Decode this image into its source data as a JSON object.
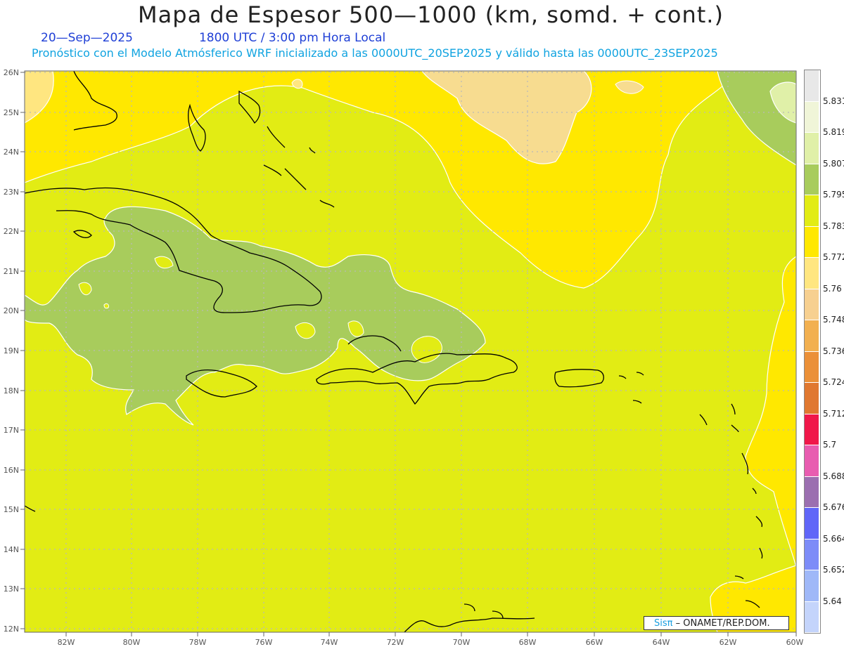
{
  "header": {
    "title": "Mapa de Espesor 500—1000 (km, somd. + cont.)",
    "date": "20—Sep—2025",
    "time": "1800 UTC / 3:00 pm Hora Local",
    "subtitle": "Pronóstico con el Modelo Atmósferico WRF inicializado a las 0000UTC_20SEP2025 y válido hasta las  0000UTC_23SEP2025"
  },
  "map": {
    "lat_labels": [
      "26N",
      "25N",
      "24N",
      "23N",
      "22N",
      "21N",
      "20N",
      "19N",
      "18N",
      "17N",
      "16N",
      "15N",
      "14N",
      "13N",
      "12N"
    ],
    "lon_labels": [
      "82W",
      "80W",
      "78W",
      "76W",
      "74W",
      "72W",
      "70W",
      "68W",
      "66W",
      "64W",
      "62W",
      "60W"
    ],
    "colors": {
      "yellow_green": "#e2ec14",
      "green": "#a8cc5c",
      "yellow": "#ffe800",
      "pale_yellow": "#ffe680",
      "tan": "#f7d890",
      "pale_green": "#e0f0a8"
    }
  },
  "legend": {
    "labels": [
      "5.831",
      "5.819",
      "5.807",
      "5.795",
      "5.783",
      "5.772",
      "5.76",
      "5.748",
      "5.736",
      "5.724",
      "5.712",
      "5.7",
      "5.688",
      "5.676",
      "5.664",
      "5.652",
      "5.64"
    ],
    "swatch_colors": [
      "#e8e8e8",
      "#f0f5d8",
      "#e0f0a8",
      "#a8cc5c",
      "#e2ec14",
      "#ffe800",
      "#ffe680",
      "#f7d090",
      "#f2b050",
      "#eb9038",
      "#e07830",
      "#f0184a",
      "#e85cb0",
      "#9b6fb0",
      "#6066f8",
      "#7d8cf8",
      "#9fb8f8",
      "#c4d4fb"
    ]
  },
  "credit": {
    "brand": "Sisπ",
    "text": " – ONAMET/REP.DOM."
  }
}
